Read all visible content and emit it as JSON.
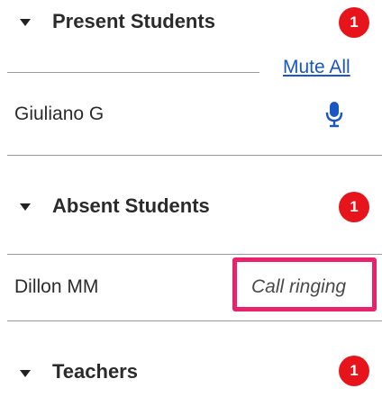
{
  "sections": [
    {
      "title": "Present Students",
      "count": "1",
      "expanded_icon": "caret-down-icon"
    },
    {
      "title": "Absent Students",
      "count": "1",
      "expanded_icon": "caret-down-icon"
    },
    {
      "title": "Teachers",
      "count": "1",
      "expanded_icon": "caret-down-icon"
    }
  ],
  "present_students": {
    "mute_all_label": "Mute All",
    "rows": [
      {
        "name": "Giuliano G",
        "mic_icon": "microphone-icon"
      }
    ]
  },
  "absent_students": {
    "rows": [
      {
        "name": "Dillon MM",
        "status": "Call ringing"
      }
    ]
  },
  "colors": {
    "badge": "#e8141c",
    "link": "#1a56c4",
    "highlight_border": "#e8236c",
    "mic_icon": "#1a56c4"
  }
}
